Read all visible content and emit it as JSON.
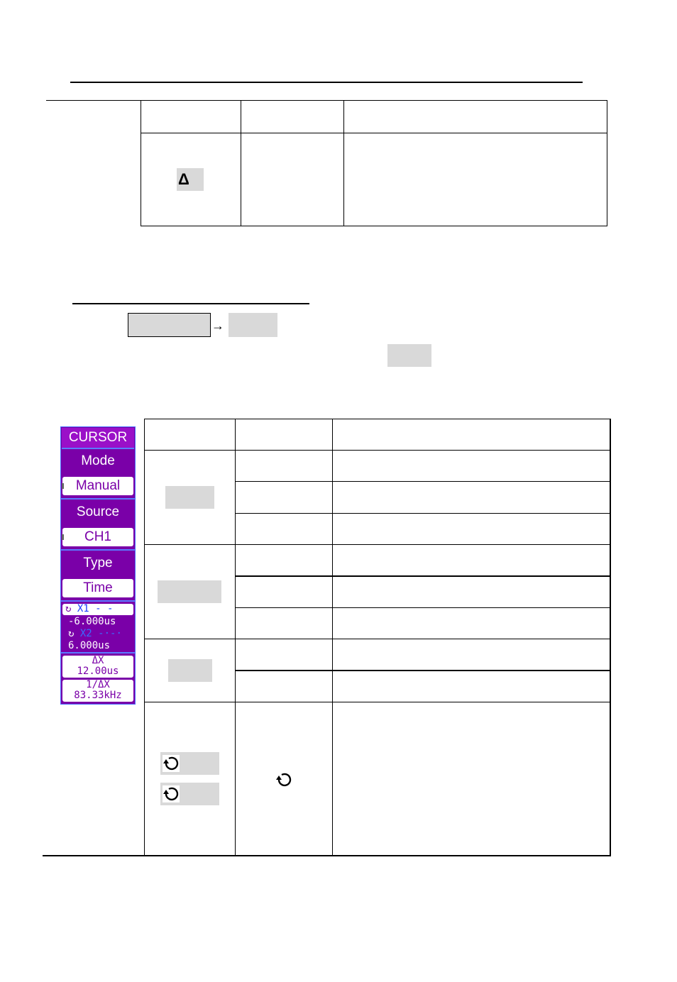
{
  "top_section": {
    "delta_symbol": "Δ"
  },
  "navigation": {
    "arrow": "→"
  },
  "cursor_menu": {
    "title": "CURSOR",
    "mode_label": "Mode",
    "mode_value": "Manual",
    "source_label": "Source",
    "source_value": "CH1",
    "type_label": "Type",
    "type_value": "Time",
    "x1_label": "X1",
    "x1_line": "- -",
    "x1_value": "-6.000us",
    "x2_label": "X2",
    "x2_line": "-·-·",
    "x2_value": "6.000us",
    "delta_x_label": "ΔX",
    "delta_x_value": "12.00us",
    "inv_delta_x_label": "1/ΔX",
    "inv_delta_x_value": "83.33kHz",
    "knob_glyph": "↻"
  },
  "colors": {
    "menu_bg": "#7a00a8",
    "menu_title_bg": "#9a10c8",
    "menu_border": "#4a6cff",
    "x1_color": "#1a3cff",
    "x2_color": "#3a6cff",
    "highlight_gray": "#d9d9d9"
  }
}
